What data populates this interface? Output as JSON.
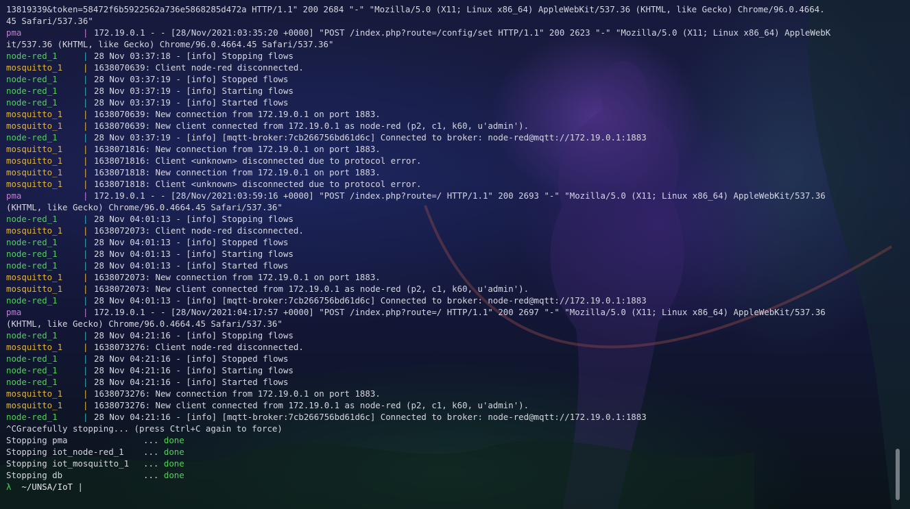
{
  "terminal": {
    "log_lines": [
      {
        "kind": "raw",
        "text": "13819339&token=58472f6b5922562a736e5868285d472a HTTP/1.1\" 200 2684 \"-\" \"Mozilla/5.0 (X11; Linux x86_64) AppleWebKit/537.36 (KHTML, like Gecko) Chrome/96.0.4664."
      },
      {
        "kind": "raw",
        "text": "45 Safari/537.36\""
      },
      {
        "kind": "svc",
        "svc": "pma",
        "name": "pma",
        "msg": "172.19.0.1 - - [28/Nov/2021:03:35:20 +0000] \"POST /index.php?route=/config/set HTTP/1.1\" 200 2623 \"-\" \"Mozilla/5.0 (X11; Linux x86_64) AppleWebK"
      },
      {
        "kind": "raw",
        "text": "it/537.36 (KHTML, like Gecko) Chrome/96.0.4664.45 Safari/537.36\""
      },
      {
        "kind": "svc",
        "svc": "node-red",
        "name": "node-red_1",
        "msg": "28 Nov 03:37:18 - [info] Stopping flows"
      },
      {
        "kind": "svc",
        "svc": "mosquitto",
        "name": "mosquitto_1",
        "msg": "1638070639: Client node-red disconnected."
      },
      {
        "kind": "svc",
        "svc": "node-red",
        "name": "node-red_1",
        "msg": "28 Nov 03:37:19 - [info] Stopped flows"
      },
      {
        "kind": "svc",
        "svc": "node-red",
        "name": "node-red_1",
        "msg": "28 Nov 03:37:19 - [info] Starting flows"
      },
      {
        "kind": "svc",
        "svc": "node-red",
        "name": "node-red_1",
        "msg": "28 Nov 03:37:19 - [info] Started flows"
      },
      {
        "kind": "svc",
        "svc": "mosquitto",
        "name": "mosquitto_1",
        "msg": "1638070639: New connection from 172.19.0.1 on port 1883."
      },
      {
        "kind": "svc",
        "svc": "mosquitto",
        "name": "mosquitto_1",
        "msg": "1638070639: New client connected from 172.19.0.1 as node-red (p2, c1, k60, u'admin')."
      },
      {
        "kind": "svc",
        "svc": "node-red",
        "name": "node-red_1",
        "msg": "28 Nov 03:37:19 - [info] [mqtt-broker:7cb266756bd61d6c] Connected to broker: node-red@mqtt://172.19.0.1:1883"
      },
      {
        "kind": "svc",
        "svc": "mosquitto",
        "name": "mosquitto_1",
        "msg": "1638071816: New connection from 172.19.0.1 on port 1883."
      },
      {
        "kind": "svc",
        "svc": "mosquitto",
        "name": "mosquitto_1",
        "msg": "1638071816: Client <unknown> disconnected due to protocol error."
      },
      {
        "kind": "svc",
        "svc": "mosquitto",
        "name": "mosquitto_1",
        "msg": "1638071818: New connection from 172.19.0.1 on port 1883."
      },
      {
        "kind": "svc",
        "svc": "mosquitto",
        "name": "mosquitto_1",
        "msg": "1638071818: Client <unknown> disconnected due to protocol error."
      },
      {
        "kind": "svc",
        "svc": "pma",
        "name": "pma",
        "msg": "172.19.0.1 - - [28/Nov/2021:03:59:16 +0000] \"POST /index.php?route=/ HTTP/1.1\" 200 2693 \"-\" \"Mozilla/5.0 (X11; Linux x86_64) AppleWebKit/537.36"
      },
      {
        "kind": "raw",
        "text": "(KHTML, like Gecko) Chrome/96.0.4664.45 Safari/537.36\""
      },
      {
        "kind": "svc",
        "svc": "node-red",
        "name": "node-red_1",
        "msg": "28 Nov 04:01:13 - [info] Stopping flows"
      },
      {
        "kind": "svc",
        "svc": "mosquitto",
        "name": "mosquitto_1",
        "msg": "1638072073: Client node-red disconnected."
      },
      {
        "kind": "svc",
        "svc": "node-red",
        "name": "node-red_1",
        "msg": "28 Nov 04:01:13 - [info] Stopped flows"
      },
      {
        "kind": "svc",
        "svc": "node-red",
        "name": "node-red_1",
        "msg": "28 Nov 04:01:13 - [info] Starting flows"
      },
      {
        "kind": "svc",
        "svc": "node-red",
        "name": "node-red_1",
        "msg": "28 Nov 04:01:13 - [info] Started flows"
      },
      {
        "kind": "svc",
        "svc": "mosquitto",
        "name": "mosquitto_1",
        "msg": "1638072073: New connection from 172.19.0.1 on port 1883."
      },
      {
        "kind": "svc",
        "svc": "mosquitto",
        "name": "mosquitto_1",
        "msg": "1638072073: New client connected from 172.19.0.1 as node-red (p2, c1, k60, u'admin')."
      },
      {
        "kind": "svc",
        "svc": "node-red",
        "name": "node-red_1",
        "msg": "28 Nov 04:01:13 - [info] [mqtt-broker:7cb266756bd61d6c] Connected to broker: node-red@mqtt://172.19.0.1:1883"
      },
      {
        "kind": "svc",
        "svc": "pma",
        "name": "pma",
        "msg": "172.19.0.1 - - [28/Nov/2021:04:17:57 +0000] \"POST /index.php?route=/ HTTP/1.1\" 200 2697 \"-\" \"Mozilla/5.0 (X11; Linux x86_64) AppleWebKit/537.36"
      },
      {
        "kind": "raw",
        "text": "(KHTML, like Gecko) Chrome/96.0.4664.45 Safari/537.36\""
      },
      {
        "kind": "svc",
        "svc": "node-red",
        "name": "node-red_1",
        "msg": "28 Nov 04:21:16 - [info] Stopping flows"
      },
      {
        "kind": "svc",
        "svc": "mosquitto",
        "name": "mosquitto_1",
        "msg": "1638073276: Client node-red disconnected."
      },
      {
        "kind": "svc",
        "svc": "node-red",
        "name": "node-red_1",
        "msg": "28 Nov 04:21:16 - [info] Stopped flows"
      },
      {
        "kind": "svc",
        "svc": "node-red",
        "name": "node-red_1",
        "msg": "28 Nov 04:21:16 - [info] Starting flows"
      },
      {
        "kind": "svc",
        "svc": "node-red",
        "name": "node-red_1",
        "msg": "28 Nov 04:21:16 - [info] Started flows"
      },
      {
        "kind": "svc",
        "svc": "mosquitto",
        "name": "mosquitto_1",
        "msg": "1638073276: New connection from 172.19.0.1 on port 1883."
      },
      {
        "kind": "svc",
        "svc": "mosquitto",
        "name": "mosquitto_1",
        "msg": "1638073276: New client connected from 172.19.0.1 as node-red (p2, c1, k60, u'admin')."
      },
      {
        "kind": "svc",
        "svc": "node-red",
        "name": "node-red_1",
        "msg": "28 Nov 04:21:16 - [info] [mqtt-broker:7cb266756bd61d6c] Connected to broker: node-red@mqtt://172.19.0.1:1883"
      },
      {
        "kind": "raw",
        "text": "^CGracefully stopping... (press Ctrl+C again to force)"
      },
      {
        "kind": "stop",
        "label": "Stopping pma",
        "dots": "...",
        "status": "done"
      },
      {
        "kind": "stop",
        "label": "Stopping iot_node-red_1",
        "dots": "...",
        "status": "done"
      },
      {
        "kind": "stop",
        "label": "Stopping iot_mosquitto_1",
        "dots": "...",
        "status": "done"
      },
      {
        "kind": "stop",
        "label": "Stopping db",
        "dots": "...",
        "status": "done"
      }
    ],
    "separator": "|",
    "prompt": {
      "symbol": "λ",
      "path": "~/UNSA/IoT",
      "cursor": "|"
    }
  },
  "colors": {
    "node_red": "#4fd15a",
    "mosquitto": "#e0b43a",
    "pma": "#c77ad8",
    "node_red_pipe": "#2fb3b8",
    "done": "#4fd15a"
  }
}
